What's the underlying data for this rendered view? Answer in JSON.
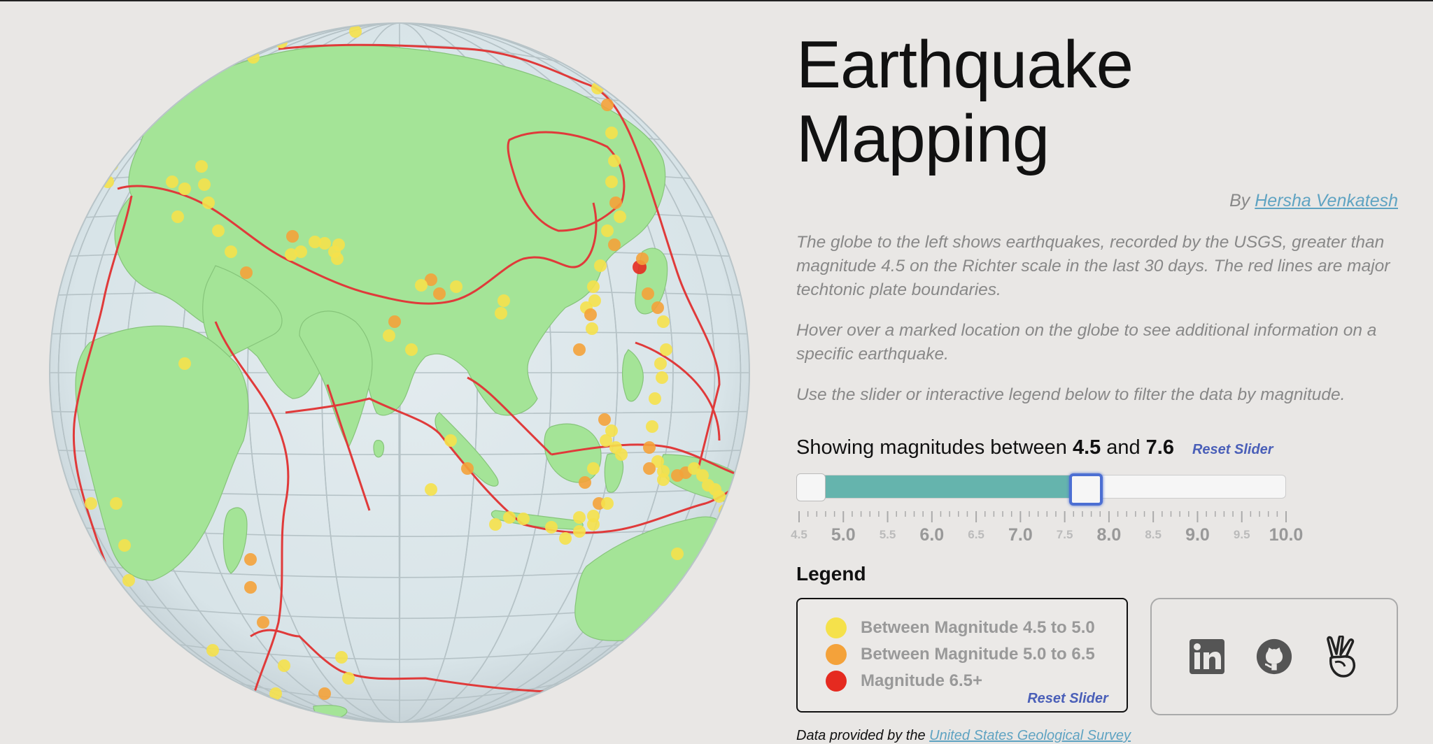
{
  "title": "Earthquake Mapping",
  "byline": {
    "prefix": "By",
    "author": "Hersha Venkatesh"
  },
  "description": [
    "The globe to the left shows earthquakes, recorded by the USGS, greater than magnitude 4.5 on the Richter scale in the last 30 days. The red lines are major techtonic plate boundaries.",
    "Hover over a marked location on the globe to see additional information on a specific earthquake.",
    "Use the slider or interactive legend below to filter the data by magnitude."
  ],
  "slider": {
    "prefix": "Showing magnitudes between",
    "and_word": "and",
    "min_value": "4.5",
    "max_value": "7.6",
    "reset_label": "Reset Slider",
    "range_min": 4.5,
    "range_max": 10.0,
    "major_ticks": [
      "5.0",
      "6.0",
      "7.0",
      "8.0",
      "9.0",
      "10.0"
    ],
    "minor_ticks": [
      "4.5",
      "5.5",
      "6.5",
      "7.5",
      "8.5",
      "9.5"
    ]
  },
  "legend": {
    "title": "Legend",
    "items": [
      {
        "label": "Between Magnitude 4.5 to 5.0",
        "color": "#f5e14b"
      },
      {
        "label": "Between Magnitude 5.0 to 6.5",
        "color": "#f4a23a"
      },
      {
        "label": "Magnitude 6.5+",
        "color": "#e52a20"
      }
    ],
    "reset_label": "Reset Slider"
  },
  "social": [
    {
      "name": "linkedin-icon"
    },
    {
      "name": "github-icon"
    },
    {
      "name": "angellist-icon"
    }
  ],
  "footer": {
    "prefix": "Data provided by the",
    "link": "United States Geological Survey"
  },
  "colors": {
    "land": "#a4e497",
    "ocean": "#dbe6ea",
    "plate_boundary": "#e03a3a",
    "slider_fill": "#65b4ad",
    "handle_focus": "#4c6fd3",
    "link": "#5fa3c2",
    "reset": "#4a5fb8"
  }
}
